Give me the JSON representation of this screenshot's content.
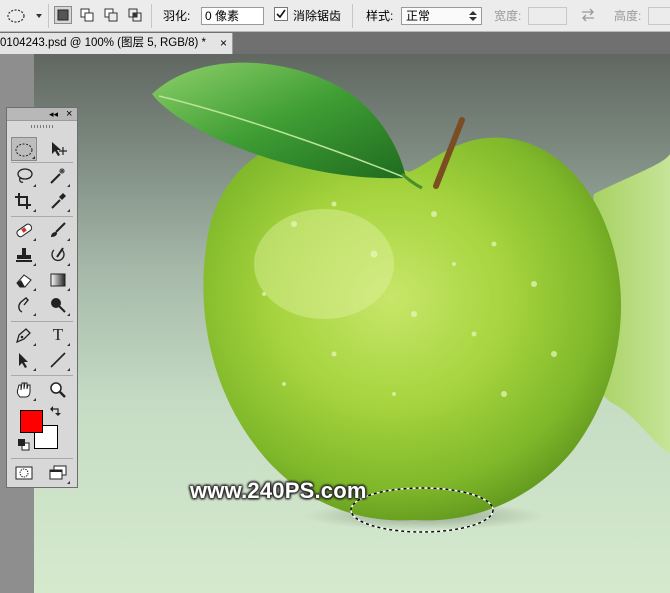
{
  "options_bar": {
    "feather_label": "羽化:",
    "feather_value": "0 像素",
    "antialias_label": "消除锯齿",
    "antialias_checked": true,
    "style_label": "样式:",
    "style_value": "正常",
    "width_label": "宽度:",
    "height_label": "高度:"
  },
  "document_tab": {
    "title": "0104243.psd @ 100% (图层 5, RGB/8) *",
    "close": "×"
  },
  "toolbox": {
    "collapse": "◂◂",
    "close": "×",
    "text_tool_glyph": "T"
  },
  "colors": {
    "foreground": "#ff0000",
    "background": "#ffffff"
  },
  "watermark": "www.240PS.com"
}
